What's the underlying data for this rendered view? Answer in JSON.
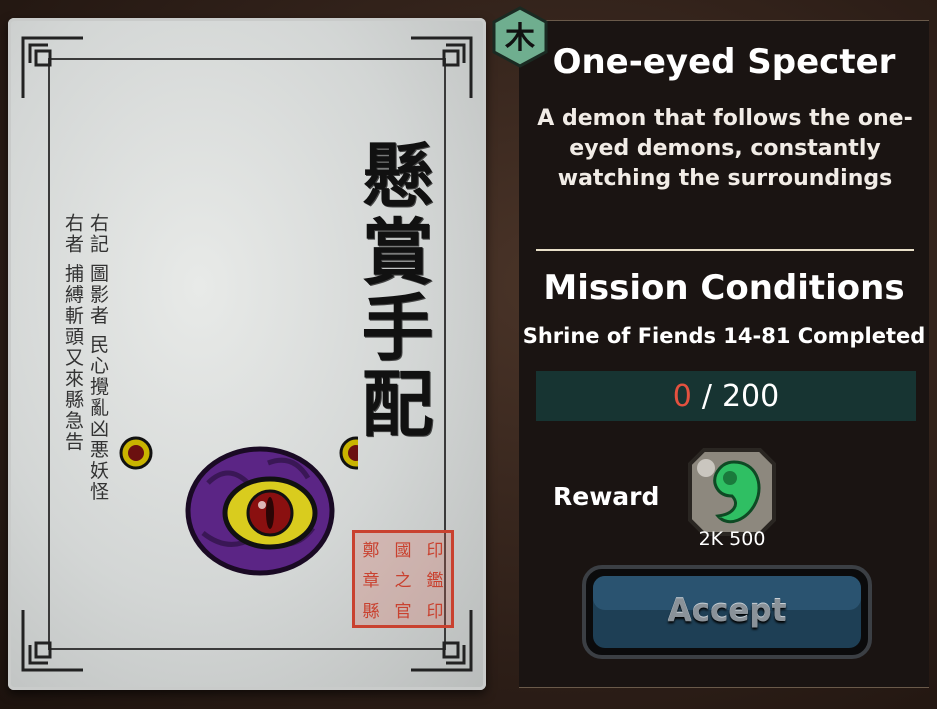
{
  "poster": {
    "title": "懸賞手配",
    "notice": "右記 圖影者 民心攪亂凶悪妖怪\n右者 捕縛斬頭又來縣急告",
    "seal_chars": [
      "鄭",
      "國",
      "印",
      "章",
      "之",
      "鑑",
      "縣",
      "官",
      "印"
    ]
  },
  "mission": {
    "element_badge": "木",
    "name": "One-eyed Specter",
    "description": "A demon that follows the one-eyed demons, constantly watching the surroundings",
    "conditions_title": "Mission Conditions",
    "condition": "Shrine of Fiends 14-81 Completed",
    "progress_current": "0",
    "progress_separator": "/",
    "progress_total": "200",
    "reward_label": "Reward",
    "reward_amount": "2K 500",
    "reward_icon": "green-magatama-icon",
    "accept_label": "Accept"
  },
  "colors": {
    "progress_bg": "#173432",
    "progress_current": "#e4513f",
    "badge": "#6fae8f",
    "seal": "#c9412f"
  }
}
